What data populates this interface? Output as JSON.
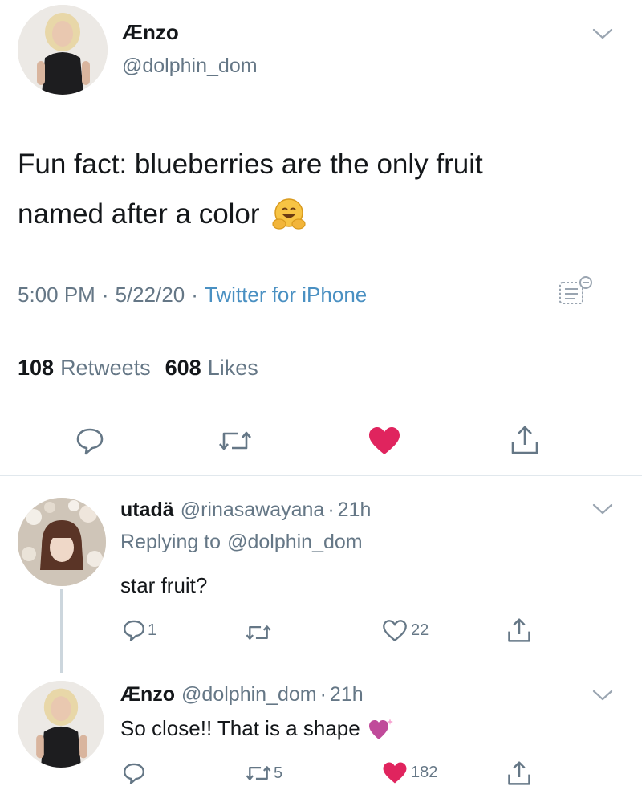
{
  "tweet": {
    "display_name": "Ænzo",
    "handle": "@dolphin_dom",
    "text_line1": "Fun fact: blueberries are the only fruit",
    "text_line2": "named after a color",
    "time": "5:00 PM",
    "date": "5/22/20",
    "sep1": "·",
    "sep2": "·",
    "source": "Twitter for iPhone",
    "retweets_count": "108",
    "retweets_label": "Retweets",
    "likes_count": "608",
    "likes_label": "Likes"
  },
  "replies": [
    {
      "display_name": "utadä",
      "handle": "@rinasawayana",
      "time": "21h",
      "sep": "·",
      "replying_prefix": "Replying to",
      "replying_to": "@dolphin_dom",
      "text": "star fruit?",
      "reply_count": "1",
      "like_count": "22"
    },
    {
      "display_name": "Ænzo",
      "handle": "@dolphin_dom",
      "time": "21h",
      "sep": "·",
      "text": "So close!! That is a shape",
      "retweet_count": "5",
      "like_count": "182"
    }
  ],
  "colors": {
    "like_active": "#e0245e",
    "muted": "#657786",
    "link": "#1da1f2"
  },
  "icons": [
    "chevron-down-icon",
    "hugging-face-emoji",
    "analytics-icon",
    "reply-icon",
    "retweet-icon",
    "heart-icon",
    "share-icon",
    "purple-heart-emoji"
  ]
}
